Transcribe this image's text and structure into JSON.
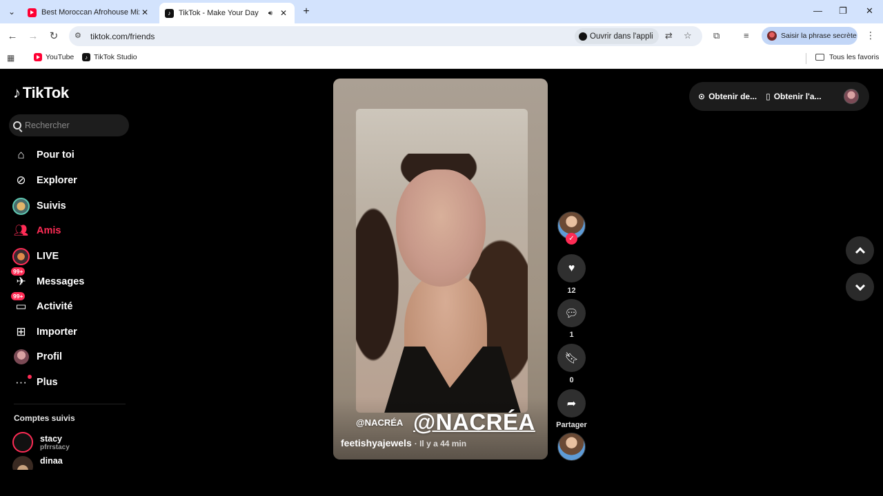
{
  "browser": {
    "tabs": [
      {
        "title": "Best Moroccan Afrohouse Mix",
        "active": false
      },
      {
        "title": "TikTok - Make Your Day",
        "active": true
      }
    ],
    "url": "tiktok.com/friends",
    "open_in_app": "Ouvrir dans l'appli",
    "passphrase": "Saisir la phrase secrète",
    "bookmarks": [
      {
        "label": "YouTube"
      },
      {
        "label": "TikTok Studio"
      }
    ],
    "all_bookmarks": "Tous les favoris"
  },
  "sidebar": {
    "logo": "TikTok",
    "search_placeholder": "Rechercher",
    "items": [
      {
        "label": "Pour toi",
        "icon": "home-icon"
      },
      {
        "label": "Explorer",
        "icon": "compass-icon"
      },
      {
        "label": "Suivis",
        "icon": "following-icon"
      },
      {
        "label": "Amis",
        "icon": "friends-icon",
        "active": true
      },
      {
        "label": "LIVE",
        "icon": "live-icon"
      },
      {
        "label": "Messages",
        "icon": "messages-icon",
        "badge": "99+"
      },
      {
        "label": "Activité",
        "icon": "activity-icon",
        "badge": "99+"
      },
      {
        "label": "Importer",
        "icon": "upload-icon"
      },
      {
        "label": "Profil",
        "icon": "profile-avatar"
      },
      {
        "label": "Plus",
        "icon": "more-icon"
      }
    ],
    "following_title": "Comptes suivis",
    "following": [
      {
        "name": "stacy",
        "handle": "pfrrstacy"
      },
      {
        "name": "dinaa",
        "handle": ""
      }
    ]
  },
  "video": {
    "watermark_small": "@NACRÉA",
    "watermark_big": "@NACRÉA",
    "username": "feetishyajewels",
    "time": "· Il y a 44 min",
    "likes": "12",
    "comments": "1",
    "saves": "0",
    "share_label": "Partager"
  },
  "topright": {
    "get_coins": "Obtenir de...",
    "get_app": "Obtenir l'a..."
  },
  "colors": {
    "accent": "#fe2c55",
    "chrome_tabbar": "#d3e3fd"
  }
}
